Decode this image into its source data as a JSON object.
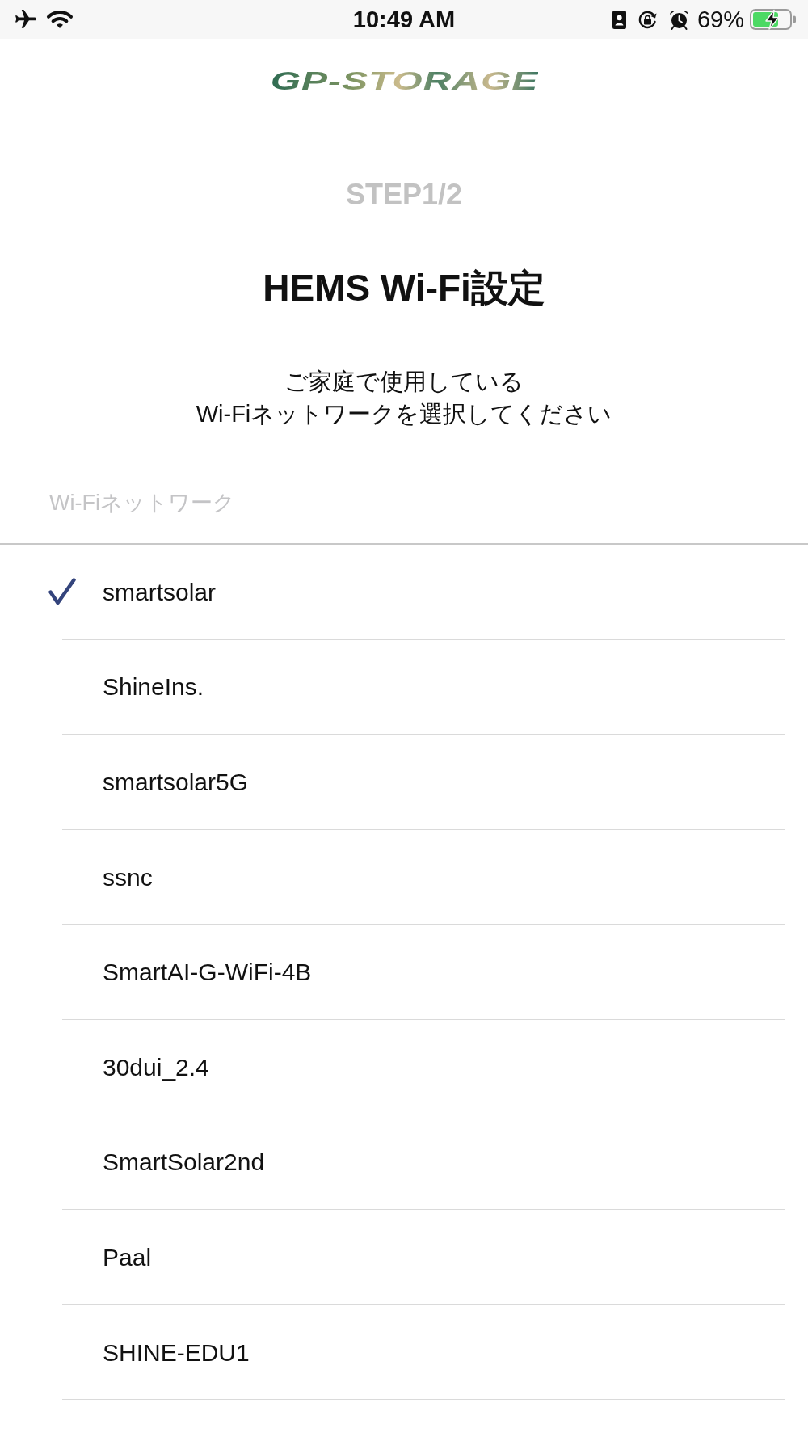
{
  "status_bar": {
    "time": "10:49 AM",
    "battery_percent": "69%"
  },
  "logo": {
    "text": "GP-STORAGE"
  },
  "step": "STEP1/2",
  "title": "HEMS Wi-Fi設定",
  "instructions": "ご家庭で使用している\nWi-Fiネットワークを選択してください",
  "network_field": {
    "placeholder": "Wi-Fiネットワーク"
  },
  "networks": [
    {
      "name": "smartsolar",
      "selected": true
    },
    {
      "name": "ShineIns.",
      "selected": false
    },
    {
      "name": "smartsolar5G",
      "selected": false
    },
    {
      "name": "ssnc",
      "selected": false
    },
    {
      "name": "SmartAI-G-WiFi-4B",
      "selected": false
    },
    {
      "name": "30dui_2.4",
      "selected": false
    },
    {
      "name": "SmartSolar2nd",
      "selected": false
    },
    {
      "name": "Paal",
      "selected": false
    },
    {
      "name": "SHINE-EDU1",
      "selected": false
    }
  ]
}
